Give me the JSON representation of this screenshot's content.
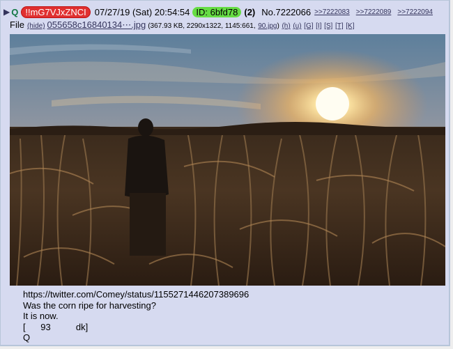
{
  "post": {
    "arrow": "▶",
    "name": "Q",
    "tripcode": "!!mG7VJxZNCI",
    "datetime": "07/27/19 (Sat) 20:54:54",
    "id_label": "ID: 6bfd78",
    "post_count": "(2)",
    "post_number": "No.7222066",
    "backlinks": [
      ">>7222083",
      ">>7222089",
      ">>7222094"
    ]
  },
  "file": {
    "label": "File",
    "hide": "(hide)",
    "filename": "055658c16840134⋯.jpg",
    "info": "(367.93 KB, 2290x1322, 1145:661,",
    "thumb_link": "90.jpg",
    "info_close": ")",
    "tools": [
      "(h)",
      "(u)",
      "[G]",
      "[I]",
      "[S]",
      "[T]",
      "[K]"
    ]
  },
  "message": {
    "lines": [
      "https://twitter.com/Comey/status/1155271446207389696",
      "Was the corn ripe for harvesting?",
      "It is now.",
      "[      93          dk]",
      "Q"
    ]
  },
  "colors": {
    "post_bg": "#d6daf0",
    "name_green": "#117743",
    "trip_red": "#e03030",
    "id_green": "#66dd44",
    "link_blue": "#34345c"
  }
}
